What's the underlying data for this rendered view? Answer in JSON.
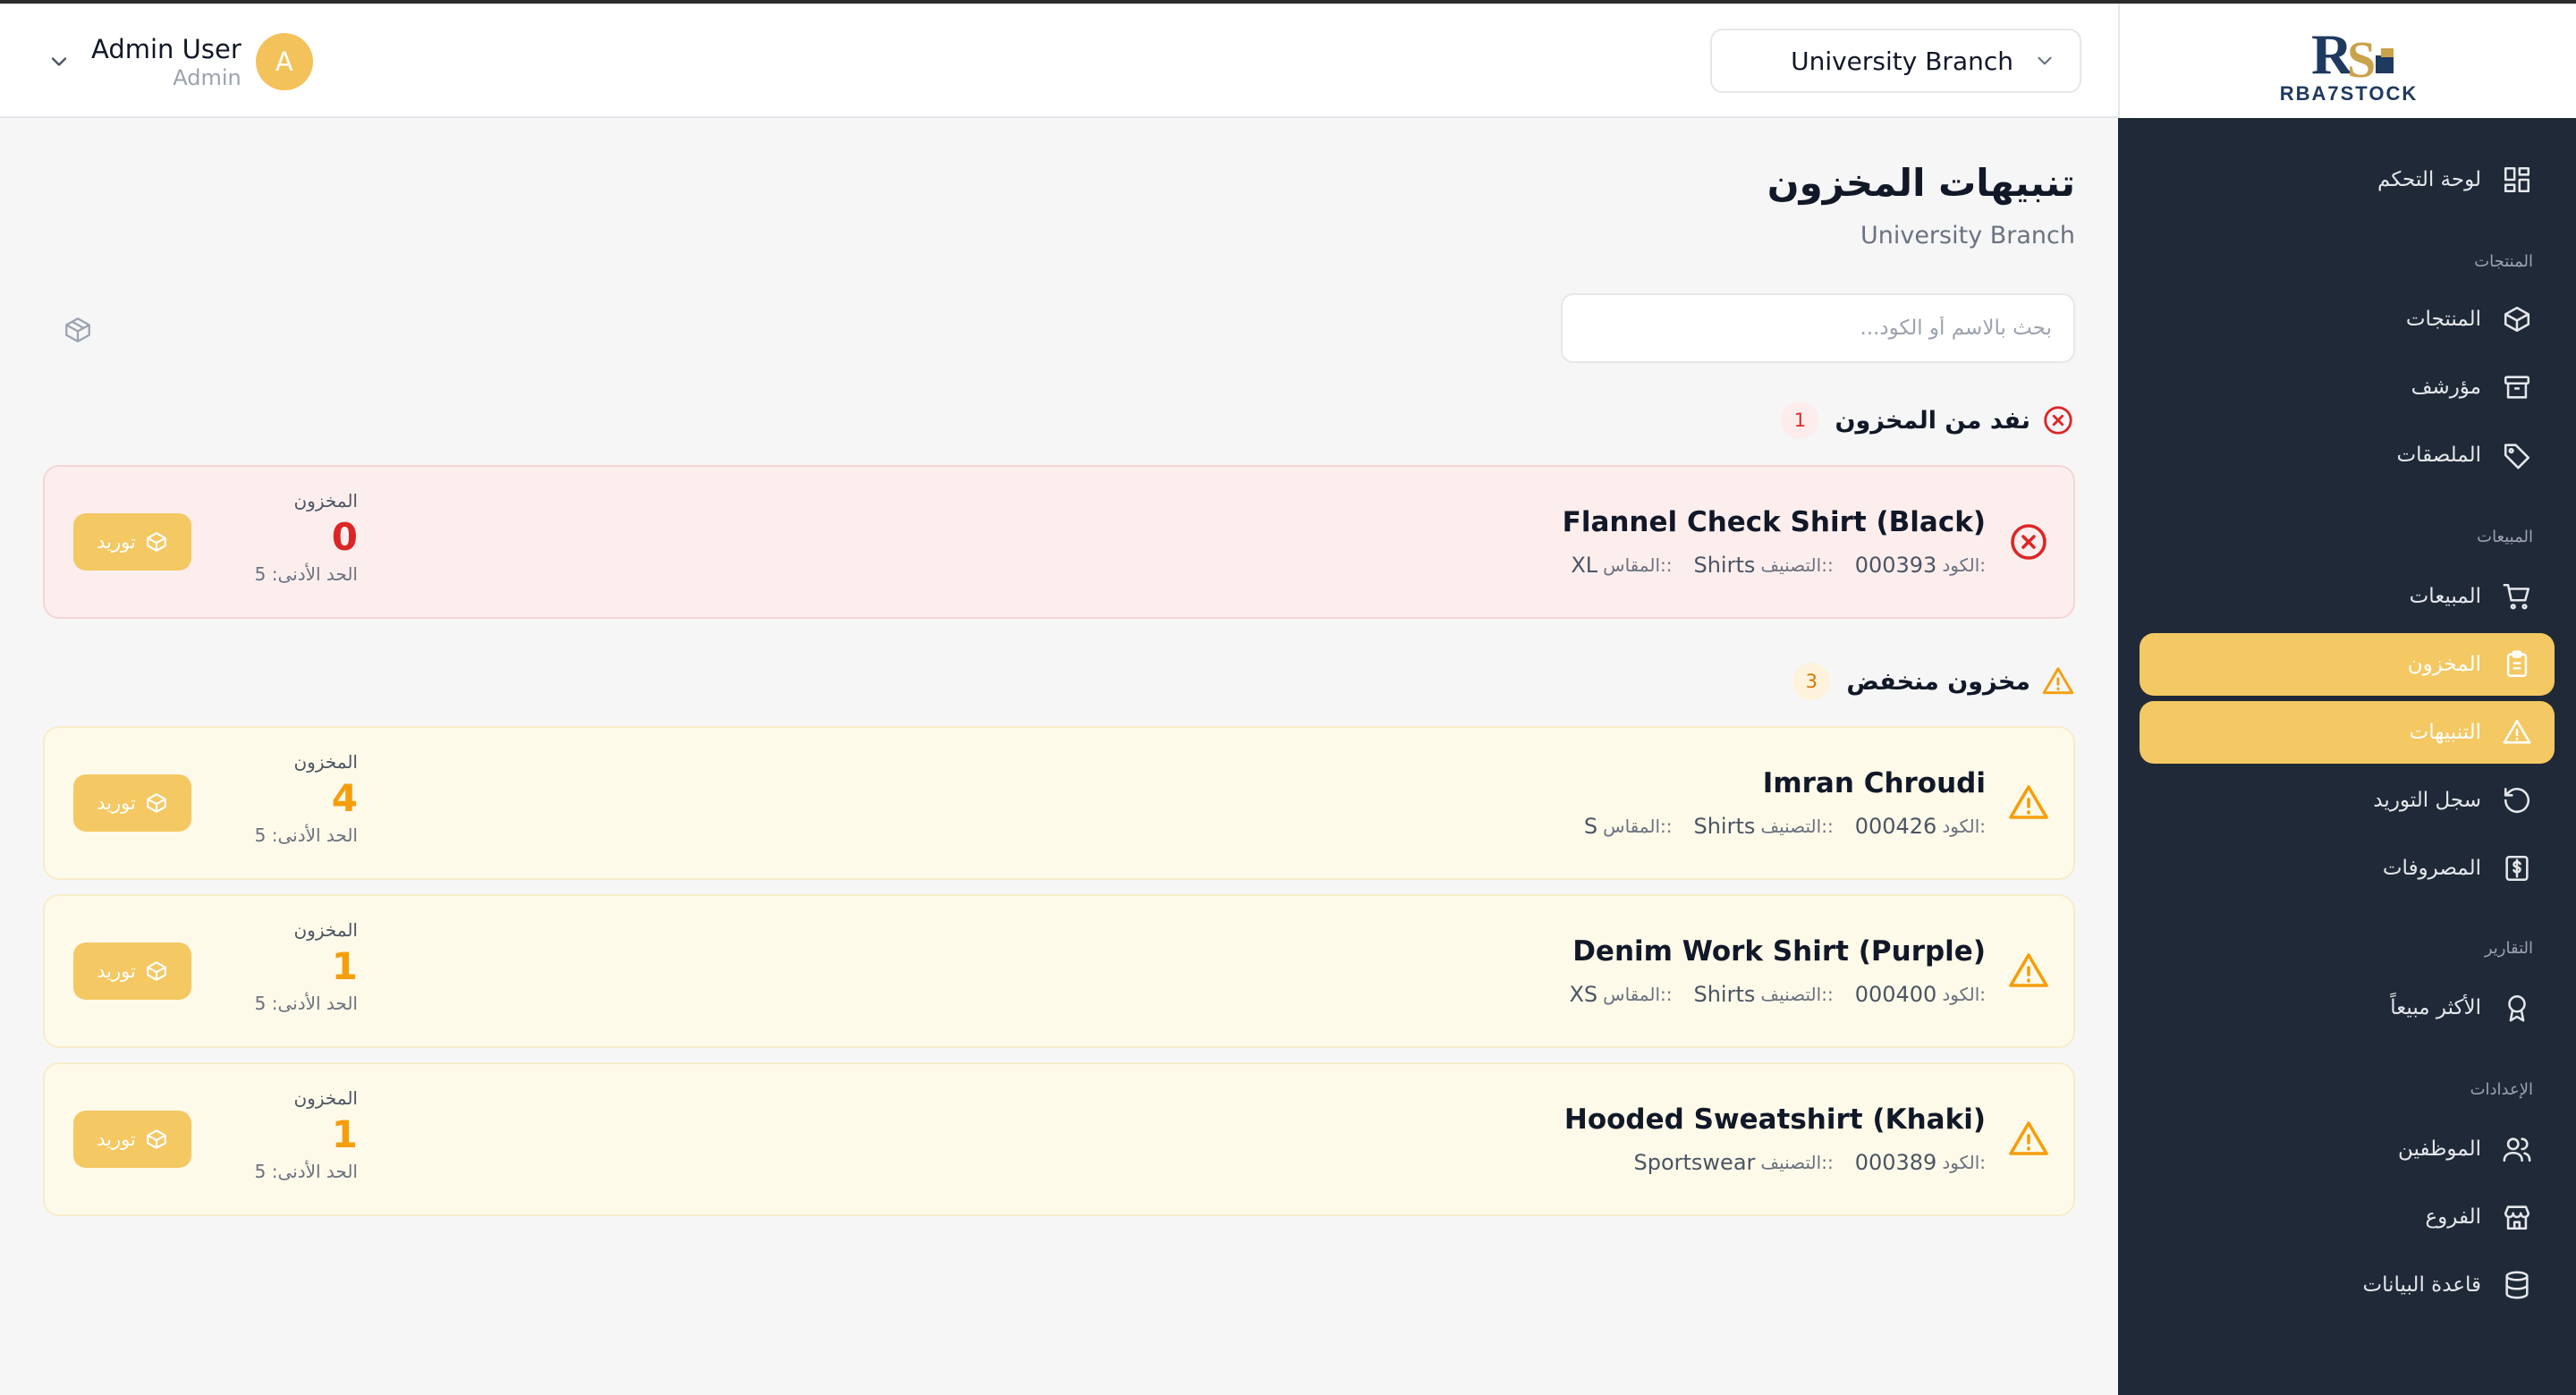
{
  "header": {
    "user_name": "Admin User",
    "user_role": "Admin",
    "avatar_initial": "A",
    "branch_selected": "University Branch"
  },
  "sidebar": {
    "logo_text": "RBA7STOCK",
    "sections": {
      "products": "المنتجات",
      "sales": "المبيعات",
      "reports": "التقارير",
      "settings": "الإعدادات"
    },
    "items": [
      {
        "label": "لوحة التحكم",
        "icon": "dashboard-grid-icon"
      },
      {
        "label": "المنتجات",
        "icon": "box-icon"
      },
      {
        "label": "مؤرشف",
        "icon": "archive-icon"
      },
      {
        "label": "الملصقات",
        "icon": "tag-icon"
      },
      {
        "label": "المبيعات",
        "icon": "cart-icon"
      },
      {
        "label": "المخزون",
        "icon": "clipboard-icon",
        "active": true
      },
      {
        "label": "التنبيهات",
        "icon": "alert-triangle-icon",
        "active": true
      },
      {
        "label": "سجل التوريد",
        "icon": "history-icon"
      },
      {
        "label": "المصروفات",
        "icon": "receipt-dollar-icon"
      },
      {
        "label": "الأكثر مبيعاً",
        "icon": "award-icon"
      },
      {
        "label": "الموظفين",
        "icon": "users-icon"
      },
      {
        "label": "الفروع",
        "icon": "store-icon"
      },
      {
        "label": "قاعدة البيانات",
        "icon": "database-icon"
      }
    ]
  },
  "page": {
    "title": "تنبيهات المخزون",
    "subtitle": "University Branch",
    "search_placeholder": "بحث بالاسم أو الكود..."
  },
  "out_of_stock": {
    "title": "نفد من المخزون",
    "count": "1",
    "items": [
      {
        "name": "Flannel Check Shirt (Black)",
        "code_label": "الكود:",
        "code": "000393",
        "category_label": "التصنيف::",
        "category": "Shirts",
        "size_label": "المقاس::",
        "size": "XL",
        "stock_label": "المخزون",
        "stock": "0",
        "min": "الحد الأدنى: 5",
        "button": "توريد"
      }
    ]
  },
  "low_stock": {
    "title": "مخزون منخفض",
    "count": "3",
    "items": [
      {
        "name": "Imran Chroudi",
        "code_label": "الكود:",
        "code": "000426",
        "category_label": "التصنيف::",
        "category": "Shirts",
        "size_label": "المقاس::",
        "size": "S",
        "stock_label": "المخزون",
        "stock": "4",
        "min": "الحد الأدنى: 5",
        "button": "توريد"
      },
      {
        "name": "Denim Work Shirt (Purple)",
        "code_label": "الكود:",
        "code": "000400",
        "category_label": "التصنيف::",
        "category": "Shirts",
        "size_label": "المقاس::",
        "size": "XS",
        "stock_label": "المخزون",
        "stock": "1",
        "min": "الحد الأدنى: 5",
        "button": "توريد"
      },
      {
        "name": "Hooded Sweatshirt (Khaki)",
        "code_label": "الكود:",
        "code": "000389",
        "category_label": "التصنيف::",
        "category": "Sportswear",
        "stock_label": "المخزون",
        "stock": "1",
        "min": "الحد الأدنى: 5",
        "button": "توريد"
      }
    ]
  },
  "colors": {
    "accent": "#f4c862",
    "sidebar_bg": "#1f2937",
    "danger": "#dc2626",
    "warning": "#f59e0b"
  }
}
